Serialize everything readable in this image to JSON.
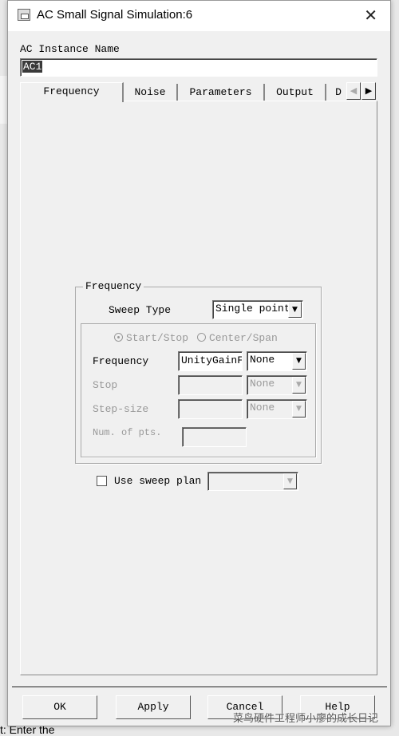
{
  "window": {
    "title": "AC Small Signal Simulation:6"
  },
  "instance": {
    "label": "AC Instance Name",
    "value": "AC1"
  },
  "tabs": [
    {
      "label": "Frequency"
    },
    {
      "label": "Noise"
    },
    {
      "label": "Parameters"
    },
    {
      "label": "Output"
    },
    {
      "label": "D"
    }
  ],
  "frequency_group": {
    "title": "Frequency",
    "sweep_type_label": "Sweep Type",
    "sweep_type_value": "Single point",
    "radio_start_stop": "Start/Stop",
    "radio_center_span": "Center/Span",
    "selected_radio": "Start/Stop",
    "rows": [
      {
        "label": "Frequency",
        "value": "UnityGainF",
        "unit": "None",
        "enabled": true
      },
      {
        "label": "Stop",
        "value": "",
        "unit": "None",
        "enabled": false
      },
      {
        "label": "Step-size",
        "value": "",
        "unit": "None",
        "enabled": false
      }
    ],
    "num_pts_label": "Num. of pts.",
    "num_pts_value": ""
  },
  "sweep_plan": {
    "label": "Use sweep plan",
    "checked": false,
    "value": ""
  },
  "buttons": {
    "ok": "OK",
    "apply": "Apply",
    "cancel": "Cancel",
    "help": "Help"
  },
  "watermark": "菜鸟硬件工程师小廖的成长日记",
  "background": {
    "status_text": "t: Enter the"
  }
}
